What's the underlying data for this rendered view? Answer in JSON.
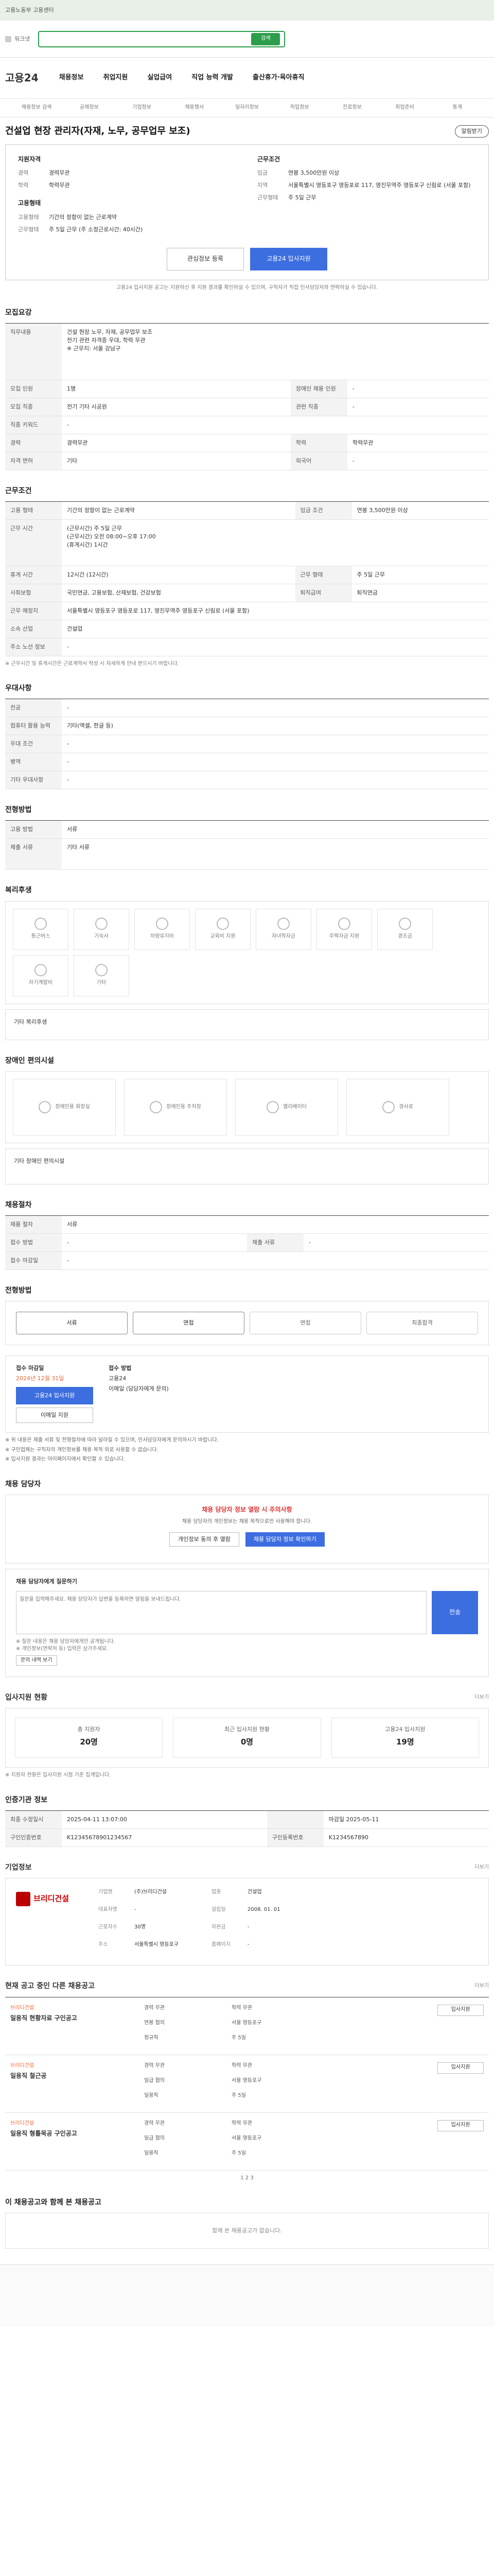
{
  "ad": {
    "text": "고용노동부 고용센터"
  },
  "gnb": {
    "label": "워크넷",
    "search_btn": "검색"
  },
  "header": {
    "logo": "고용24",
    "nav": [
      "채용정보",
      "취업지원",
      "실업급여",
      "직업 능력 개발",
      "출산휴가·육아휴직"
    ],
    "subnav": [
      "채용정보 검색",
      "공채정보",
      "기업정보",
      "채용행사",
      "일자리정보",
      "직업정보",
      "진로정보",
      "취업준비",
      "통계"
    ]
  },
  "job": {
    "title": "건설업 현장 관리자(자재, 노무, 공무업무 보조)",
    "alarm": "알림받기",
    "req_head": "지원자격",
    "req": [
      {
        "k": "경력",
        "v": "경력무관"
      },
      {
        "k": "학력",
        "v": "학력무관"
      }
    ],
    "cond_head": "근무조건",
    "cond": [
      {
        "k": "임금",
        "v": "연봉 3,500만원 이상"
      },
      {
        "k": "지역",
        "v": "서울특별시 영등포구 영등포로 117, 영진무역주 영등포구 신림로 (서울 포함)"
      },
      {
        "k": "근무형태",
        "v": "주 5일 근무"
      }
    ],
    "mgr_head": "고용형태",
    "mgr": [
      {
        "k": "고용형태",
        "v": "기간의 정함이 없는 근로계약"
      },
      {
        "k": "근무형태",
        "v": "주 5일 근무 (주 소정근로시간: 40시간)"
      }
    ],
    "btn_save": "관심정보 등록",
    "btn_apply": "고용24 입사지원",
    "notice": "고용24 입사지원 공고는 지원하신 후 지원 결과를 확인하실 수 있으며, 구직자가 직접 인사담당자와 연락하실 수 있습니다."
  },
  "recruit": {
    "head": "모집요강",
    "duty_label": "직무내용",
    "duty": "건설 현장 노무, 자재, 공무업무 보조\n전기 관련 자격증 우대, 학력 무관\n※ 근무지: 서울 강남구",
    "rows": [
      [
        "모집 인원",
        "1명",
        "장애인 채용 인원",
        "-"
      ],
      [
        "모집 직종",
        "전기 기타 시공원",
        "관련 직종",
        "-"
      ],
      [
        "직종 키워드",
        "-",
        "",
        ""
      ],
      [
        "경력",
        "경력무관",
        "학력",
        "학력무관"
      ],
      [
        "자격 면허",
        "기타",
        "외국어",
        "-"
      ]
    ]
  },
  "workcond": {
    "head": "근무조건",
    "rows": [
      [
        "고용 형태",
        "기간의 정함이 없는 근로계약",
        "임금 조건",
        "연봉 3,500만원 이상"
      ],
      [
        "",
        "주 소정근로시간: 40시간",
        "",
        ""
      ],
      [
        "근무 시간",
        "(근무시간) 주 5일 근무\n(근무시간) 오전 08:00~오후 17:00\n(휴게시간) 1시간",
        "",
        ""
      ],
      [
        "휴게 시간",
        "12시간 (12시간)",
        "근무 형태",
        "주 5일 근무"
      ],
      [
        "사회보험",
        "국민연금, 고용보험, 산재보험, 건강보험",
        "퇴직급여",
        "퇴직연금"
      ],
      [
        "근무 예정지",
        "서울특별시 영등포구 영등포로 117, 영진무역주 영등포구 신림로 (서울 포함)",
        "",
        ""
      ],
      [
        "소속 산업",
        "건설업",
        "",
        ""
      ],
      [
        "주소 노선 정보",
        "-",
        "",
        ""
      ]
    ],
    "note": "※ 근무시간 및 휴게시간은 근로계약서 작성 시 자세하게 안내 받으시기 바랍니다."
  },
  "prefer": {
    "head": "우대사항",
    "rows": [
      [
        "전공",
        "-"
      ],
      [
        "컴퓨터 활용 능력",
        "기타(엑셀, 한글 등)"
      ],
      [
        "우대 조건",
        "-"
      ],
      [
        "병역",
        "-"
      ],
      [
        "기타 우대사항",
        "-"
      ]
    ]
  },
  "process": {
    "head": "전형방법",
    "rows": [
      [
        "고용 방법",
        "서류"
      ],
      [
        "제출 서류",
        "기타 서류"
      ]
    ]
  },
  "welfare": {
    "head": "복리후생",
    "items": [
      "통근버스",
      "기숙사",
      "차량유지비",
      "교육비 지원",
      "자녀학자금",
      "주택자금 지원",
      "경조금",
      "자기계발비",
      "기타"
    ],
    "other": "기타 복리후생"
  },
  "disabled": {
    "head": "장애인 편의시설",
    "items": [
      "장애인용 화장실",
      "장애인용 주차장",
      "엘리베이터",
      "경사로"
    ],
    "other": "기타 장애인 편의시설"
  },
  "hire": {
    "head": "채용절차",
    "rows": [
      [
        "채용 절차",
        "서류",
        "",
        ""
      ],
      [
        "접수 방법",
        "-",
        "제출 서류",
        "-"
      ],
      [
        "접수 마감일",
        "-",
        "",
        ""
      ]
    ]
  },
  "steps": {
    "head": "전형방법",
    "items": [
      "서류",
      "면접",
      "면접",
      "최종합격"
    ]
  },
  "apply": {
    "title1": "접수 마감일",
    "deadline": "2024년 12월 31일",
    "btn": "고용24 입사지원",
    "btn2": "이메일 지원",
    "title2": "접수 방법",
    "methods": [
      "고용24",
      "이메일 (담당자에게 문의)"
    ]
  },
  "bullets": [
    "※ 위 내용은 제출 서류 및 전형절차에 따라 달라질 수 있으며, 인사담당자에게 문의하시기 바랍니다.",
    "※ 구인업체는 구직자의 개인정보를 채용 목적 외로 사용할 수 없습니다.",
    "※ 입사지원 결과는 마이페이지에서 확인할 수 있습니다."
  ],
  "mgr": {
    "head": "채용 담당자",
    "warn": "채용 담당자 정보 열람 시 주의사항",
    "desc": "채용 담당자의 개인정보는 채용 목적으로만 사용해야 합니다.",
    "btn1": "개인정보 동의 후 열람",
    "btn2": "채용 담당자 정보 확인하기"
  },
  "ask": {
    "label": "채용 담당자에게 질문하기",
    "placeholder": "질문을 입력해주세요. 채용 담당자가 답변을 등록하면 알림을 보내드립니다.",
    "send": "전송",
    "notes": [
      "※ 질문 내용은 채용 담당자에게만 공개됩니다.",
      "※ 개인정보(연락처 등) 입력은 삼가주세요."
    ],
    "more": "문의 내역 보기"
  },
  "stats": {
    "head": "입사지원 현황",
    "more": "더보기",
    "cards": [
      {
        "l": "총 지원자",
        "n": "20명"
      },
      {
        "l": "최근 입사지원 현황",
        "n": "0명"
      },
      {
        "l": "고용24 입사지원",
        "n": "19명"
      }
    ],
    "note": "※ 지원자 현황은 입사지원 시점 기준 집계입니다."
  },
  "info": {
    "head": "인증기관 정보",
    "rows": [
      [
        "최종 수정일시",
        "2025-04-11 13:07:00",
        "",
        "마감일 2025-05-11"
      ],
      [
        "구인인증번호",
        "K12345678901234567",
        "구인등록번호",
        "K1234567890"
      ]
    ]
  },
  "company": {
    "head": "기업정보",
    "more": "더보기",
    "name": "브리디건설",
    "info": [
      [
        "기업명",
        "(주)브리디건설",
        "업종",
        "건설업"
      ],
      [
        "대표자명",
        "-",
        "설립일",
        "2008. 01. 01"
      ],
      [
        "근로자수",
        "30명",
        "자본금",
        "-"
      ],
      [
        "주소",
        "서울특별시 영등포구",
        "홈페이지",
        "-"
      ]
    ]
  },
  "others": {
    "head": "현재 공고 중인 다른 채용공고",
    "more": "더보기",
    "items": [
      {
        "cn": "브리디건설",
        "tt": "일용직 현황자료 구인공고",
        "d": [
          "경력 무관",
          "학력 무관",
          "연봉 협의",
          "서울 영등포구",
          "정규직",
          "주 5일"
        ],
        "btn": "입사지원"
      },
      {
        "cn": "브리디건설",
        "tt": "일용직 철근공",
        "d": [
          "경력 무관",
          "학력 무관",
          "일급 협의",
          "서울 영등포구",
          "일용직",
          "주 5일"
        ],
        "btn": "입사지원"
      },
      {
        "cn": "브리디건설",
        "tt": "일용직 형틀목공 구인공고",
        "d": [
          "경력 무관",
          "학력 무관",
          "일급 협의",
          "서울 영등포구",
          "일용직",
          "주 5일"
        ],
        "btn": "입사지원"
      }
    ],
    "pager": "1 2 3"
  },
  "reco": {
    "head": "이 채용공고와 함께 본 채용공고",
    "empty": "함께 본 채용공고가 없습니다."
  }
}
